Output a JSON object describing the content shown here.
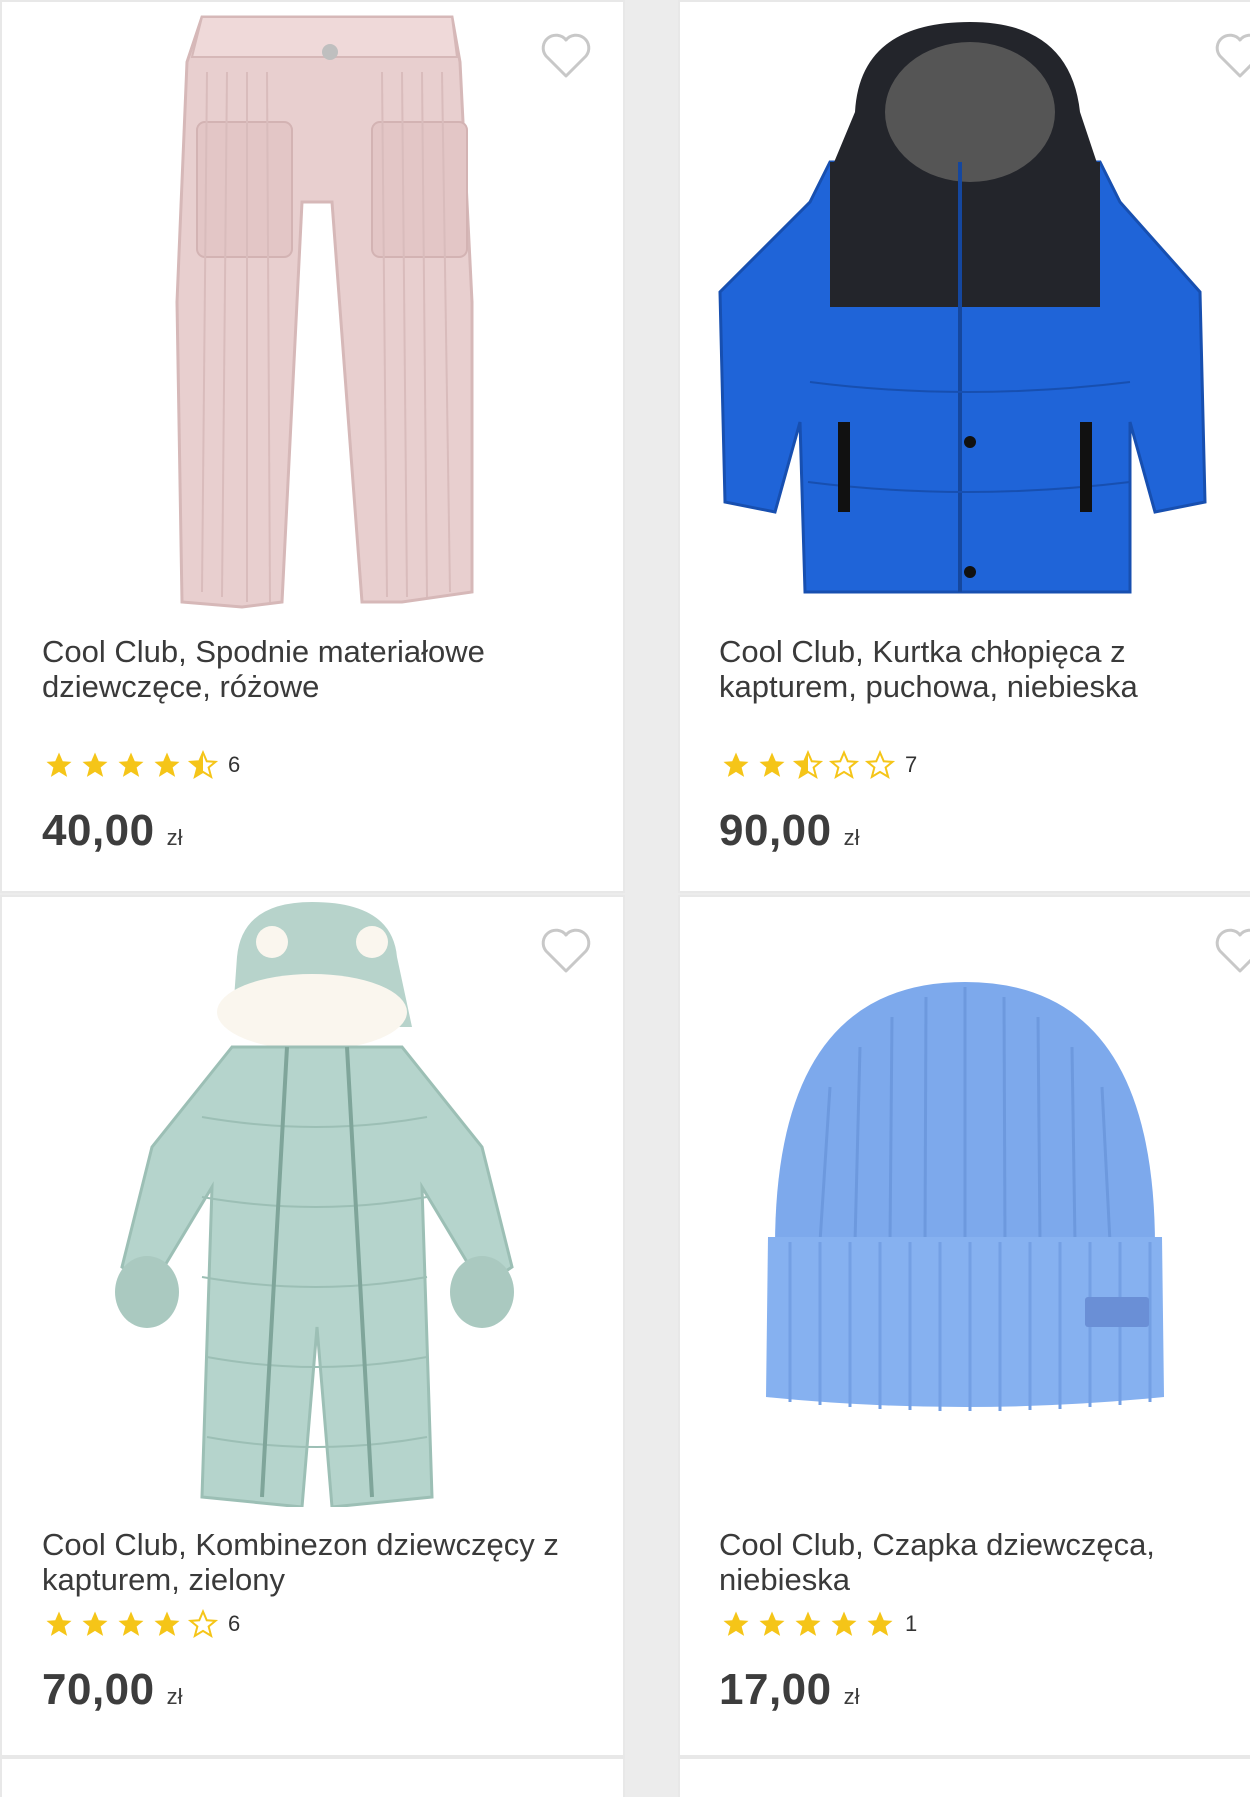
{
  "products": [
    {
      "title": "Cool Club, Spodnie materiałowe dziewczęce, różowe",
      "rating": 4.5,
      "rating_count": "6",
      "price": "40,00",
      "currency": "zł"
    },
    {
      "title": "Cool Club, Kurtka chłopięca z kapturem, puchowa, niebieska",
      "rating": 2.5,
      "rating_count": "7",
      "price": "90,00",
      "currency": "zł"
    },
    {
      "title": "Cool Club, Kombinezon dziewczęcy z kapturem, zielony",
      "rating": 4,
      "rating_count": "6",
      "price": "70,00",
      "currency": "zł"
    },
    {
      "title": "Cool Club, Czapka dziewczęca, niebieska",
      "rating": 5,
      "rating_count": "1",
      "price": "17,00",
      "currency": "zł"
    }
  ],
  "colors": {
    "star": "#f5c518",
    "text": "#3a3a3a",
    "heart": "#c8c8c8"
  }
}
